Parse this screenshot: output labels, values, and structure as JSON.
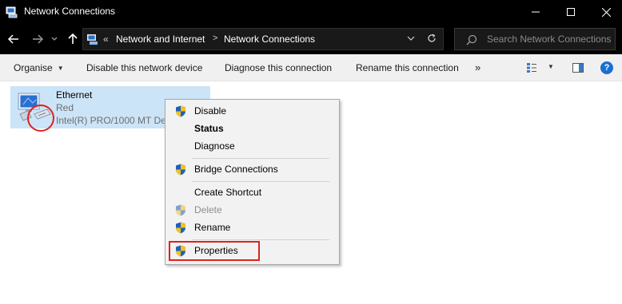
{
  "window": {
    "title": "Network Connections"
  },
  "address": {
    "prefix": "«",
    "crumbs": [
      "Network and Internet",
      "Network Connections"
    ],
    "separator": ">"
  },
  "search": {
    "placeholder": "Search Network Connections"
  },
  "commands": {
    "organise": "Organise",
    "disable": "Disable this network device",
    "diagnose": "Diagnose this connection",
    "rename": "Rename this connection",
    "more": "»"
  },
  "adapter": {
    "name": "Ethernet",
    "status": "Red",
    "device": "Intel(R) PRO/1000 MT Desktop Adapter"
  },
  "context_menu": {
    "items": [
      {
        "label": "Disable",
        "shield": true,
        "bold": false,
        "disabled": false
      },
      {
        "label": "Status",
        "shield": false,
        "bold": true,
        "disabled": false
      },
      {
        "label": "Diagnose",
        "shield": false,
        "bold": false,
        "disabled": false
      },
      {
        "label": "Bridge Connections",
        "shield": true,
        "bold": false,
        "disabled": false
      },
      {
        "label": "Create Shortcut",
        "shield": false,
        "bold": false,
        "disabled": false
      },
      {
        "label": "Delete",
        "shield": true,
        "bold": false,
        "disabled": true
      },
      {
        "label": "Rename",
        "shield": true,
        "bold": false,
        "disabled": false
      },
      {
        "label": "Properties",
        "shield": true,
        "bold": false,
        "disabled": false
      }
    ]
  },
  "colors": {
    "titlebar": "#000000",
    "selection": "#cce4f7",
    "annotation_red": "#e0211d",
    "shield_blue": "#1f5fbf",
    "shield_yellow": "#f2c21b"
  }
}
